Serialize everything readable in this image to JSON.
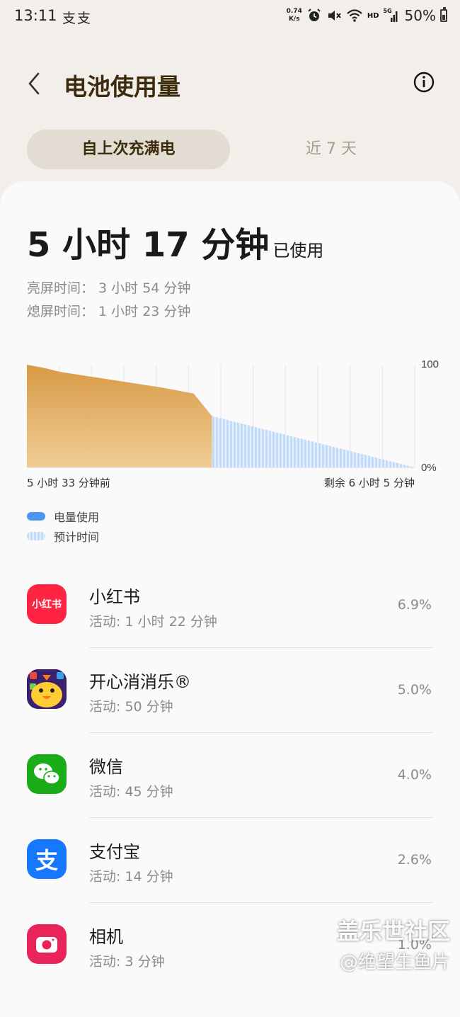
{
  "status_bar": {
    "time": "13:11",
    "extra": "支支",
    "net_speed_value": "0.74",
    "net_speed_unit": "K/s",
    "hd_label": "HD",
    "signal_label": "5G",
    "battery_percent": "50%",
    "battery_level": 0.5,
    "icons": [
      "alarm-icon",
      "mute-icon",
      "wifi-icon",
      "signal-icon",
      "battery-icon"
    ]
  },
  "header": {
    "title": "电池使用量",
    "back_icon": "chevron-left-icon",
    "info_icon": "info-icon"
  },
  "tabs": [
    {
      "label": "自上次充满电",
      "active": true
    },
    {
      "label": "近 7 天",
      "active": false
    }
  ],
  "summary": {
    "used_value": "5 小时 17 分钟",
    "used_suffix": "已使用",
    "screen_on": "亮屏时间： 3 小时 54 分钟",
    "screen_off": "熄屏时间：  1 小时 23 分钟"
  },
  "chart_data": {
    "type": "area",
    "title": "",
    "ylim": [
      0,
      100
    ],
    "y_tick_labels": [
      "100",
      "0%"
    ],
    "x_start_label": "5 小时 33 分钟前",
    "x_end_label": "剩余 6 小时 5 分钟",
    "grid": true,
    "series": [
      {
        "name": "电量使用",
        "x": [
          0,
          0.5,
          1,
          2,
          3,
          4,
          5,
          5.55
        ],
        "values": [
          100,
          97,
          93,
          88,
          83,
          78,
          72,
          50
        ],
        "color": "#dba354"
      },
      {
        "name": "预计时间",
        "x": [
          5.55,
          11.63
        ],
        "values": [
          50,
          0
        ],
        "color": "#c3dbf6"
      }
    ],
    "x_range": [
      0,
      11.63
    ]
  },
  "legend": {
    "used": "电量使用",
    "estimate": "预计时间"
  },
  "apps": [
    {
      "name": "小红书",
      "activity": "活动: 1 小时 22 分钟",
      "percent": "6.9%",
      "icon": "xiaohongshu-icon",
      "icon_text": "小红书",
      "color": "#ff2442"
    },
    {
      "name": "开心消消乐®",
      "activity": "活动: 50 分钟",
      "percent": "5.0%",
      "icon": "happy-elements-icon",
      "color": "#ffcc33"
    },
    {
      "name": "微信",
      "activity": "活动: 45 分钟",
      "percent": "4.0%",
      "icon": "wechat-icon",
      "color": "#1aad19"
    },
    {
      "name": "支付宝",
      "activity": "活动: 14 分钟",
      "percent": "2.6%",
      "icon": "alipay-icon",
      "icon_text": "支",
      "color": "#1677ff"
    },
    {
      "name": "相机",
      "activity": "活动: 3 分钟",
      "percent": "1.0%",
      "icon": "camera-icon",
      "color": "#e8245a"
    }
  ],
  "watermark": {
    "line1": "盖乐世社区",
    "line2": "@绝望生鱼片"
  }
}
